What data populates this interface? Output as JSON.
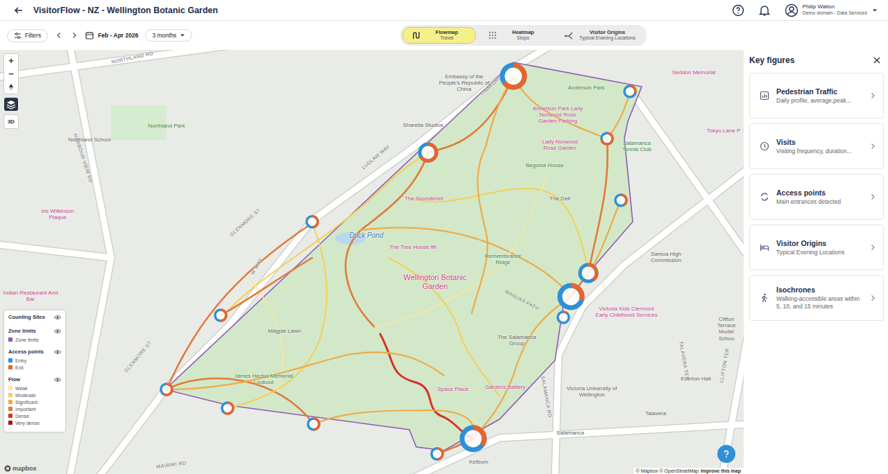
{
  "header": {
    "title": "VisitorFlow - NZ - Wellington Botanic Garden",
    "user": {
      "name": "Philip Walton",
      "org": "Demo domain - Data Services"
    }
  },
  "toolbar": {
    "filters": "Filters",
    "period": "Feb - Apr 2026",
    "range": "3 months"
  },
  "view_tabs": [
    {
      "label": "Flowmap",
      "sub": "Travel",
      "selected": true
    },
    {
      "label": "Heatmap",
      "sub": "Stops",
      "selected": false
    },
    {
      "label": "Visitor Origins",
      "sub": "Typical Evening Locations",
      "selected": false
    }
  ],
  "map": {
    "controls": {
      "zoom_in": "+",
      "zoom_out": "−",
      "mode": "3D"
    },
    "labels": [
      {
        "text": "NORTHLAND RD",
        "kind": "street"
      },
      {
        "text": "HARBOUR VIEW RD",
        "kind": "street"
      },
      {
        "text": "Northland Park",
        "kind": "park"
      },
      {
        "text": "Northland School",
        "kind": "place"
      },
      {
        "text": "Iris Wilkinson Plaque",
        "kind": "poi"
      },
      {
        "text": "GLENMORE ST",
        "kind": "street"
      },
      {
        "text": "GLENMORE ST",
        "kind": "street"
      },
      {
        "text": "Embassy of the People's Republic of China",
        "kind": "place"
      },
      {
        "text": "Sharella Studios",
        "kind": "place"
      },
      {
        "text": "TINAKORI RD",
        "kind": "street"
      },
      {
        "text": "LUDLAM WAY",
        "kind": "street"
      },
      {
        "text": "Anderson Park",
        "kind": "park"
      },
      {
        "text": "Seddon Memorial",
        "kind": "poi"
      },
      {
        "text": "Anderson Park Lady Norwood Rose Garden Parking",
        "kind": "poi"
      },
      {
        "text": "Lady Norwood Rose Garden",
        "kind": "poi"
      },
      {
        "text": "Begonia House",
        "kind": "park"
      },
      {
        "text": "Salamanca Tennis Club",
        "kind": "park"
      },
      {
        "text": "Tokyo Lane P",
        "kind": "poi"
      },
      {
        "text": "The Soundshell",
        "kind": "poi"
      },
      {
        "text": "Duck Pond",
        "kind": "water"
      },
      {
        "text": "The Tree House lift",
        "kind": "poi"
      },
      {
        "text": "The Dell",
        "kind": "place"
      },
      {
        "text": "Remembrance Ridge",
        "kind": "park"
      },
      {
        "text": "Samoa High Commission",
        "kind": "place"
      },
      {
        "text": "Wellington Botanic Garden",
        "kind": "title"
      },
      {
        "text": "MANUKA PATH",
        "kind": "street"
      },
      {
        "text": "SALAMANCA RD",
        "kind": "street"
      },
      {
        "text": "Victoria Kids Clermont Early Childhood Services",
        "kind": "poi"
      },
      {
        "text": "Clifton Terrace Model Schoo",
        "kind": "place"
      },
      {
        "text": "TALAVERA TER",
        "kind": "street"
      },
      {
        "text": "CLIFTON TER",
        "kind": "street"
      },
      {
        "text": "Magpie Lawn",
        "kind": "place"
      },
      {
        "text": "W WAY",
        "kind": "street"
      },
      {
        "text": "The Salamanca Group",
        "kind": "place"
      },
      {
        "text": "James Hector Memorial Lookout",
        "kind": "park"
      },
      {
        "text": "Space Place",
        "kind": "poi"
      },
      {
        "text": "Gardens Battery",
        "kind": "poi"
      },
      {
        "text": "Victoria University of Wellington",
        "kind": "place"
      },
      {
        "text": "Everton Hall",
        "kind": "place"
      },
      {
        "text": "Talavera",
        "kind": "place"
      },
      {
        "text": "Salamanca",
        "kind": "place"
      },
      {
        "text": "Kelburn",
        "kind": "place"
      },
      {
        "text": "Indian Restaurant And Bar",
        "kind": "poi"
      },
      {
        "text": "MAIRIRI RD",
        "kind": "street"
      }
    ],
    "access_points": [
      {
        "level": 0.35,
        "size": "large"
      },
      {
        "level": 0.7,
        "size": "small"
      },
      {
        "level": 0.3,
        "size": "small"
      },
      {
        "level": 0.6,
        "size": "small"
      },
      {
        "level": 0.35,
        "size": "medium"
      },
      {
        "level": 0.55,
        "size": "small"
      },
      {
        "level": 0.6,
        "size": "medium"
      },
      {
        "level": 0.7,
        "size": "large"
      },
      {
        "level": 0.9,
        "size": "small"
      },
      {
        "level": 0.65,
        "size": "large"
      },
      {
        "level": 0.5,
        "size": "small"
      },
      {
        "level": 0.5,
        "size": "small"
      },
      {
        "level": 0.4,
        "size": "small"
      },
      {
        "level": 0.4,
        "size": "small"
      },
      {
        "level": 0.5,
        "size": "small"
      }
    ],
    "flows": [
      {
        "kind": "important"
      },
      {
        "kind": "important"
      },
      {
        "kind": "moderate"
      },
      {
        "kind": "important"
      },
      {
        "kind": "significant"
      },
      {
        "kind": "important"
      },
      {
        "kind": "important"
      },
      {
        "kind": "significant"
      },
      {
        "kind": "dense"
      },
      {
        "kind": "important"
      },
      {
        "kind": "significant"
      },
      {
        "kind": "moderate"
      },
      {
        "kind": "moderate"
      },
      {
        "kind": "weak"
      },
      {
        "kind": "weak"
      },
      {
        "kind": "significant"
      },
      {
        "kind": "moderate"
      },
      {
        "kind": "significant"
      },
      {
        "kind": "significant"
      },
      {
        "kind": "important"
      },
      {
        "kind": "significant"
      },
      {
        "kind": "significant"
      },
      {
        "kind": "important"
      },
      {
        "kind": "significant"
      }
    ],
    "attribution": "© Mapbox © OpenStreetMap",
    "improve": "Improve this map",
    "logo": "mapbox"
  },
  "legend": {
    "sections": [
      {
        "title": "Counting Sites",
        "visible": true,
        "items": []
      },
      {
        "title": "Zone limits",
        "visible": true,
        "items": [
          {
            "label": "Zone limits",
            "kind": "zone",
            "color": "#8e5bb5"
          }
        ]
      },
      {
        "title": "Access points",
        "visible": true,
        "items": [
          {
            "label": "Entry",
            "kind": "entry",
            "color": "#2f8fd8"
          },
          {
            "label": "Exit",
            "kind": "exit",
            "color": "#e8642a"
          }
        ]
      },
      {
        "title": "Flow",
        "visible": true,
        "items": [
          {
            "label": "Weak",
            "kind": "weak",
            "color": "#f8e7a0"
          },
          {
            "label": "Moderate",
            "kind": "moderate",
            "color": "#f4cf55"
          },
          {
            "label": "Significant",
            "kind": "significant",
            "color": "#f0aa45"
          },
          {
            "label": "Important",
            "kind": "important",
            "color": "#e07b3a"
          },
          {
            "label": "Dense",
            "kind": "dense",
            "color": "#d93025"
          },
          {
            "label": "Very dense",
            "kind": "very-dense",
            "color": "#a3181a"
          }
        ]
      }
    ]
  },
  "key_figures": {
    "title": "Key figures",
    "cards": [
      {
        "title": "Pedestrian Traffic",
        "sub": "Daily profile, average,peak...",
        "kind": "traffic"
      },
      {
        "title": "Visits",
        "sub": "Visiting frequency, duration...",
        "kind": "visits"
      },
      {
        "title": "Access points",
        "sub": "Main entrances detected",
        "kind": "access"
      },
      {
        "title": "Visitor Origins",
        "sub": "Typical Evening Locations",
        "kind": "origins"
      },
      {
        "title": "Isochrones",
        "sub": "Walking-accessible areas within 5, 10, and 15 minutes",
        "kind": "isochrones"
      }
    ]
  }
}
